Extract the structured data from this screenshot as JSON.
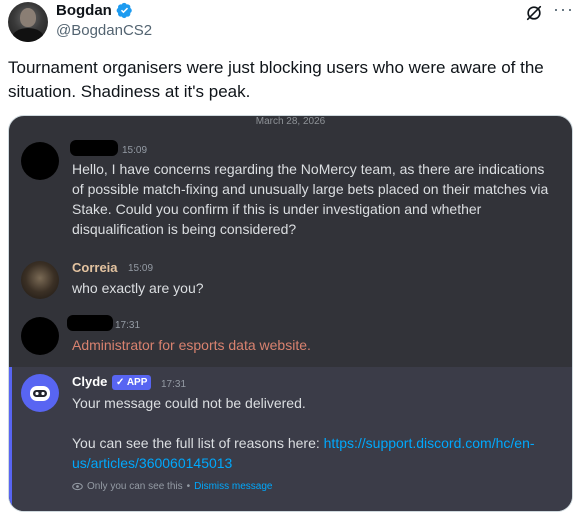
{
  "tweet": {
    "author_name": "Bogdan",
    "handle": "@BogdanCS2",
    "text": "Tournament organisers were just blocking users who were aware of the situation. Shadiness at it's peak.",
    "more_label": "···"
  },
  "discord": {
    "date": "March 28, 2026",
    "messages": [
      {
        "time": "15:09",
        "text": "Hello, I have concerns regarding the NoMercy team, as there are indications of possible match-fixing and unusually large bets placed on their matches via Stake. Could you confirm if this is under investigation and whether disqualification is being considered?"
      },
      {
        "author": "Correia",
        "time": "15:09",
        "text": "who exactly are you?"
      },
      {
        "time": "17:31",
        "text": "Administrator for esports data website."
      }
    ],
    "clyde": {
      "author": "Clyde",
      "badge": "APP",
      "time": "17:31",
      "line1": "Your message could not be delivered.",
      "line2_prefix": "You can see the full list of reasons here: ",
      "link_part1": "https://support.discord.com/hc/en-",
      "link_part2": "us/articles/360060145013",
      "only_you": "Only you can see this",
      "separator": " • ",
      "dismiss": "Dismiss message"
    }
  },
  "colors": {
    "verified_blue": "#1d9bf0",
    "discord_bg": "#323339",
    "clyde_accent": "#5865f2",
    "link_blue": "#00a8fc",
    "admin_text": "#d9826f"
  }
}
